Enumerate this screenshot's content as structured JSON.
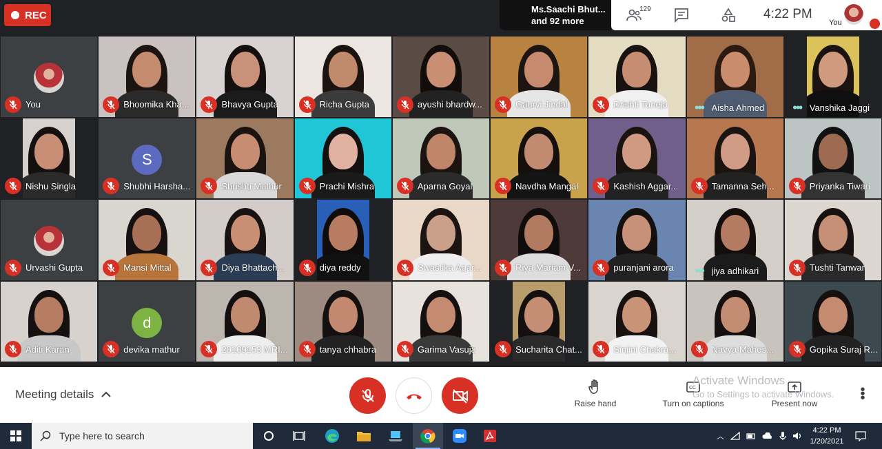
{
  "topbar": {
    "rec_label": "REC",
    "presenter_line1": "Ms.Saachi Bhut...",
    "presenter_line2": "and 92 more",
    "people_count": "129",
    "clock": "4:22 PM",
    "self_label": "You"
  },
  "participants": [
    {
      "name": "You",
      "kind": "photo-avatar",
      "bg": "#3c4043",
      "status": "muted"
    },
    {
      "name": "Bhoomika Kha...",
      "kind": "video",
      "bg": "#c9c2c0",
      "status": "muted",
      "skin": "#c58b6e",
      "hair": "#1b1410",
      "shirt": "#2a2a2a"
    },
    {
      "name": "Bhavya Gupta",
      "kind": "video",
      "bg": "#d8d3d2",
      "status": "muted",
      "skin": "#c9917a",
      "hair": "#141010",
      "shirt": "#1b1b1b"
    },
    {
      "name": "Richa Gupta",
      "kind": "video",
      "bg": "#ebe6e0",
      "status": "muted",
      "skin": "#c28a6c",
      "hair": "#1a1310",
      "shirt": "#3b3b3b"
    },
    {
      "name": "ayushi bhardw...",
      "kind": "video",
      "bg": "#5a4c45",
      "status": "muted",
      "skin": "#c98f72",
      "hair": "#120d0b",
      "shirt": "#222"
    },
    {
      "name": "Gaurvi Jindal",
      "kind": "video",
      "bg": "#b88240",
      "status": "muted",
      "skin": "#c68a6f",
      "hair": "#1d1511",
      "shirt": "#e6e6e6"
    },
    {
      "name": "Drishti Taneja",
      "kind": "video",
      "bg": "#e3dcc3",
      "status": "muted",
      "skin": "#c78d73",
      "hair": "#181210",
      "shirt": "#f0f0f0"
    },
    {
      "name": "Aisha Ahmed",
      "kind": "video",
      "bg": "#a16c48",
      "status": "speaking",
      "skin": "#c98c6d",
      "hair": "#2a1a12",
      "shirt": "#4e5b70"
    },
    {
      "name": "Vanshika Jaggi",
      "kind": "video-narrow",
      "bg": "#dcc25a",
      "status": "speaking",
      "skin": "#cf9a7e",
      "hair": "#1a130f",
      "shirt": "#0f0f0f"
    },
    {
      "name": "Nishu Singla",
      "kind": "video-narrow",
      "bg": "#d6d0cf",
      "status": "muted",
      "skin": "#c98f76",
      "hair": "#141010",
      "shirt": "#2a2a2a"
    },
    {
      "name": "Shubhi Harsha...",
      "kind": "letter-avatar",
      "letter": "S",
      "avatar_color": "#5c6bc0",
      "bg": "#3c4043",
      "status": "muted"
    },
    {
      "name": "Shrishti Mathur",
      "kind": "video",
      "bg": "#9c7a5f",
      "status": "muted",
      "skin": "#c78d72",
      "hair": "#1b130f",
      "shirt": "#d9d9d9"
    },
    {
      "name": "Prachi Mishra",
      "kind": "video",
      "bg": "#21c6d6",
      "status": "muted",
      "skin": "#e0b0a0",
      "hair": "#151010",
      "shirt": "#1a1a1a"
    },
    {
      "name": "Aparna Goyal",
      "kind": "video",
      "bg": "#bfc8b8",
      "status": "muted",
      "skin": "#c08669",
      "hair": "#1b1411",
      "shirt": "#2b2b2b"
    },
    {
      "name": "Navdha Mangal",
      "kind": "video",
      "bg": "#c9a24c",
      "status": "muted",
      "skin": "#c28a70",
      "hair": "#150f0d",
      "shirt": "#141414"
    },
    {
      "name": "Kashish Aggar...",
      "kind": "video",
      "bg": "#6f5f8a",
      "status": "muted",
      "skin": "#d09a82",
      "hair": "#1a1410",
      "shirt": "#222"
    },
    {
      "name": "Tamanna Seh...",
      "kind": "video",
      "bg": "#b7774f",
      "status": "muted",
      "skin": "#d19c86",
      "hair": "#1c1410",
      "shirt": "#222"
    },
    {
      "name": "Priyanka Tiwari",
      "kind": "video",
      "bg": "#bcc4c4",
      "status": "muted",
      "skin": "#9c6b52",
      "hair": "#111",
      "shirt": "#333"
    },
    {
      "name": "Urvashi Gupta",
      "kind": "photo-avatar",
      "bg": "#3c4043",
      "status": "muted"
    },
    {
      "name": "Mansi Mittal",
      "kind": "video",
      "bg": "#d9d5cf",
      "status": "muted",
      "skin": "#a76f55",
      "hair": "#161010",
      "shirt": "#b8753b"
    },
    {
      "name": "Diya Bhattach...",
      "kind": "video",
      "bg": "#d3ccc8",
      "status": "muted",
      "skin": "#c98f75",
      "hair": "#181312",
      "shirt": "#2b3d55"
    },
    {
      "name": "diya reddy",
      "kind": "video-narrow",
      "bg": "#2a5fb8",
      "status": "muted",
      "skin": "#b87c62",
      "hair": "#0f0c0b",
      "shirt": "#111"
    },
    {
      "name": "Swastika Agar...",
      "kind": "video",
      "bg": "#e9d7c7",
      "status": "muted",
      "skin": "#caa08a",
      "hair": "#1c1411",
      "shirt": "#eee"
    },
    {
      "name": "Riya Mariam V...",
      "kind": "video",
      "bg": "#4d3a38",
      "status": "muted",
      "skin": "#b27a60",
      "hair": "#100c0b",
      "shirt": "#ddd"
    },
    {
      "name": "puranjani arora",
      "kind": "video",
      "bg": "#6a86b0",
      "status": "muted",
      "skin": "#c79078",
      "hair": "#141010",
      "shirt": "#222"
    },
    {
      "name": "jiya adhikari",
      "kind": "video",
      "bg": "#d4cec8",
      "status": "speaking",
      "skin": "#b47b62",
      "hair": "#130e0c",
      "shirt": "#1b1b1b"
    },
    {
      "name": "Tushti Tanwar",
      "kind": "video",
      "bg": "#dcd6d0",
      "status": "muted",
      "skin": "#c69078",
      "hair": "#171110",
      "shirt": "#2a2a2a"
    },
    {
      "name": "Aditi Karan",
      "kind": "video",
      "bg": "#d8d2ce",
      "status": "muted",
      "skin": "#b67d63",
      "hair": "#151010",
      "shirt": "#c8c8c8"
    },
    {
      "name": "devika mathur",
      "kind": "letter-avatar",
      "letter": "d",
      "avatar_color": "#7cb342",
      "bg": "#3c4043",
      "status": "muted"
    },
    {
      "name": "20109153 MRI...",
      "kind": "video",
      "bg": "#bdb6ae",
      "status": "muted",
      "skin": "#c08a70",
      "hair": "#151010",
      "shirt": "#eee"
    },
    {
      "name": "tanya chhabra",
      "kind": "video",
      "bg": "#9d8a80",
      "status": "muted",
      "skin": "#c28870",
      "hair": "#141010",
      "shirt": "#222"
    },
    {
      "name": "Garima Vasuja",
      "kind": "video",
      "bg": "#e8e2dc",
      "status": "muted",
      "skin": "#c48b71",
      "hair": "#151010",
      "shirt": "#3a3a3a"
    },
    {
      "name": "Sucharita Chat...",
      "kind": "video-narrow",
      "bg": "#b99c6c",
      "status": "muted",
      "skin": "#c48d74",
      "hair": "#141010",
      "shirt": "#2a2a2a"
    },
    {
      "name": "Sinjini Chakra...",
      "kind": "video",
      "bg": "#dad4ce",
      "status": "muted",
      "skin": "#c99378",
      "hair": "#171110",
      "shirt": "#f2f2f2"
    },
    {
      "name": "Navya Mahes...",
      "kind": "video",
      "bg": "#c9c3be",
      "status": "muted",
      "skin": "#c48c72",
      "hair": "#151010",
      "shirt": "#ddd"
    },
    {
      "name": "Gopika Suraj R...",
      "kind": "video",
      "bg": "#3c4a50",
      "status": "muted",
      "skin": "#c48b70",
      "hair": "#151010",
      "shirt": "#222"
    }
  ],
  "bottombar": {
    "meeting_details": "Meeting details",
    "raise_hand": "Raise hand",
    "captions": "Turn on captions",
    "present_now": "Present now",
    "watermark_title": "Activate Windows",
    "watermark_sub": "Go to Settings to activate Windows."
  },
  "taskbar": {
    "search_placeholder": "Type here to search",
    "time": "4:22 PM",
    "date": "1/20/2021"
  },
  "colors": {
    "red": "#d93025",
    "dark": "#202124",
    "taskbar": "#1f2a3b"
  }
}
